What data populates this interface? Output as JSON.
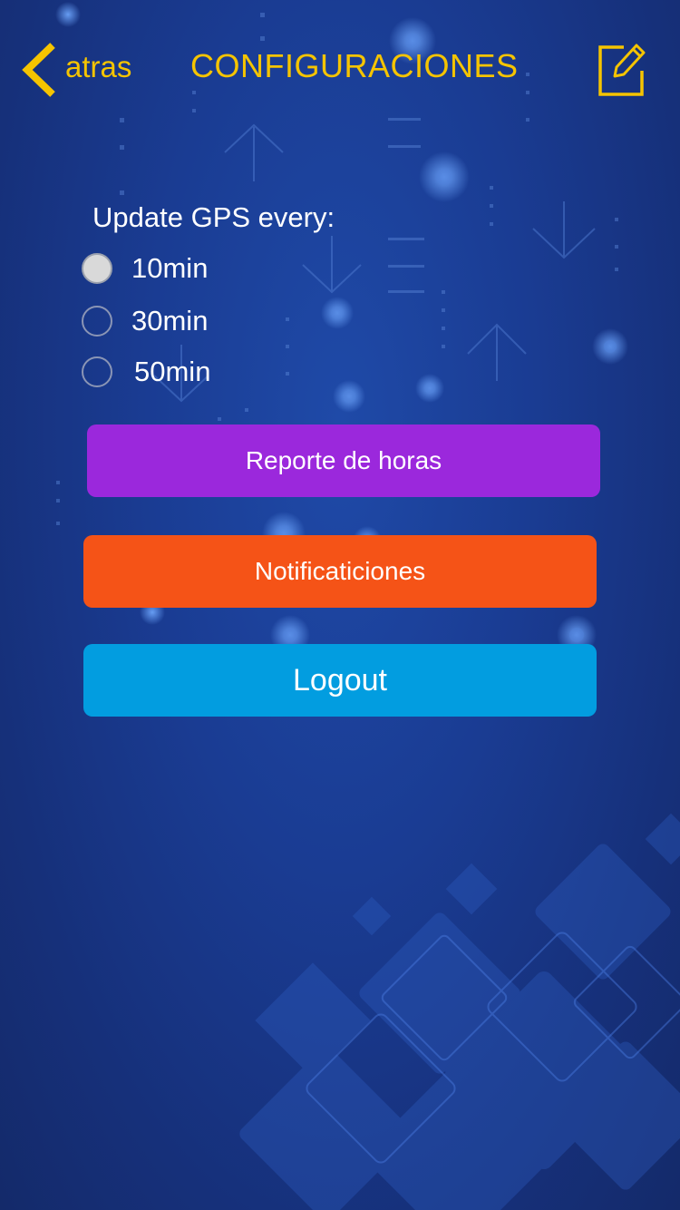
{
  "header": {
    "back_label": "atras",
    "title": "CONFIGURACIONES",
    "back_icon": "chevron-left-icon",
    "edit_icon": "edit-icon",
    "accent_color": "#f5c400"
  },
  "gps": {
    "label": "Update GPS every:",
    "selected": "10min",
    "options": [
      {
        "label": "10min",
        "checked": true
      },
      {
        "label": "30min",
        "checked": false
      },
      {
        "label": "50min",
        "checked": false
      }
    ]
  },
  "buttons": {
    "reporte_label": "Reporte de horas",
    "reporte_color": "#9b28dc",
    "notificaciones_label": "Notificaticiones",
    "notificaciones_color": "#f55317",
    "logout_label": "Logout",
    "logout_color": "#029de0"
  }
}
